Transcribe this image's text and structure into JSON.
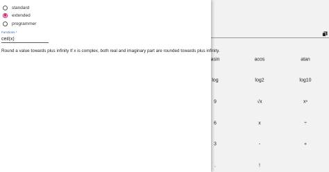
{
  "mode_options": [
    {
      "label": "standard",
      "checked": false
    },
    {
      "label": "extended",
      "checked": true
    },
    {
      "label": "programmer",
      "checked": false
    }
  ],
  "functions_field": {
    "label": "Functions *",
    "value": "ceil(x)"
  },
  "description": "Round a value towards plus infinity If x is complex, both real and imaginary part are rounded towards plus infinity.",
  "keypad": {
    "row1": [
      "asin",
      "acos",
      "atan"
    ],
    "row2": [
      "log",
      "log2",
      "log10"
    ],
    "row3": [
      "9",
      "√x",
      "xⁿ"
    ],
    "row4": [
      "6",
      "x",
      "÷"
    ],
    "row5": [
      "3",
      "-",
      "+"
    ],
    "row6": [
      ".",
      "!"
    ]
  },
  "colors": {
    "accent_pink": "#e91e63",
    "accent_blue": "#1e63c8"
  },
  "icons": {
    "copy": "copy-icon"
  }
}
